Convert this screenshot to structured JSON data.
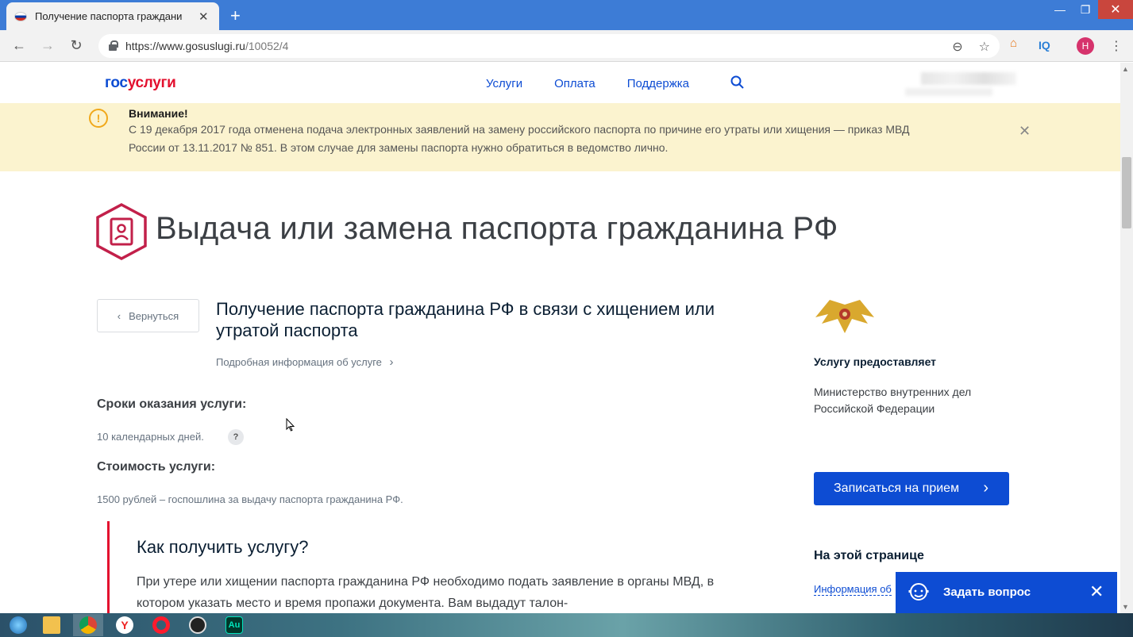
{
  "browser": {
    "tab_title": "Получение паспорта граждани",
    "tab_close": "✕",
    "new_tab": "+",
    "url_host": "https://www.gosuslugi.ru",
    "url_path": "/10052/4",
    "profile_initial": "Н",
    "ext_iq": "IQ"
  },
  "header": {
    "logo_a": "гос",
    "logo_b": "услуги",
    "nav": [
      "Услуги",
      "Оплата",
      "Поддержка"
    ]
  },
  "alert": {
    "title": "Внимание!",
    "text": "С 19 декабря 2017 года отменена подача электронных заявлений на замену российского паспорта по причине его утраты или хищения — приказ МВД России от 13.11.2017 № 851. В этом случае для замены паспорта нужно обратиться в ведомство лично.",
    "icon_glyph": "!",
    "close": "✕",
    "color_bg": "#fbf3cf"
  },
  "page": {
    "title": "Выдача или замена паспорта гражданина РФ",
    "back_label": "Вернуться",
    "service_title": "Получение паспорта гражданина РФ в связи с хищением или утратой паспорта",
    "more_info": "Подробная информация об услуге",
    "terms_h": "Сроки оказания услуги:",
    "terms_v": "10 календарных дней.",
    "help": "?",
    "cost_h": "Стоимость услуги:",
    "cost_v": "1500 рублей – госпошлина за выдачу паспорта гражданина РФ.",
    "howto_h": "Как получить услугу?",
    "howto_text": "При утере или хищении паспорта гражданина РФ необходимо подать заявление в органы МВД, в котором указать место и время пропажи документа. Вам выдадут талон-"
  },
  "sidebar": {
    "provider_h": "Услугу предоставляет",
    "provider_name": "Министерство внутренних дел Российской Федерации",
    "appoint_label": "Записаться на прием",
    "onpage_h": "На этой странице",
    "onpage_link": "Информация об",
    "ask_label": "Задать вопрос",
    "ask_close": "✕"
  },
  "colors": {
    "brand_blue": "#0d4cd3",
    "brand_red": "#e3102e"
  }
}
